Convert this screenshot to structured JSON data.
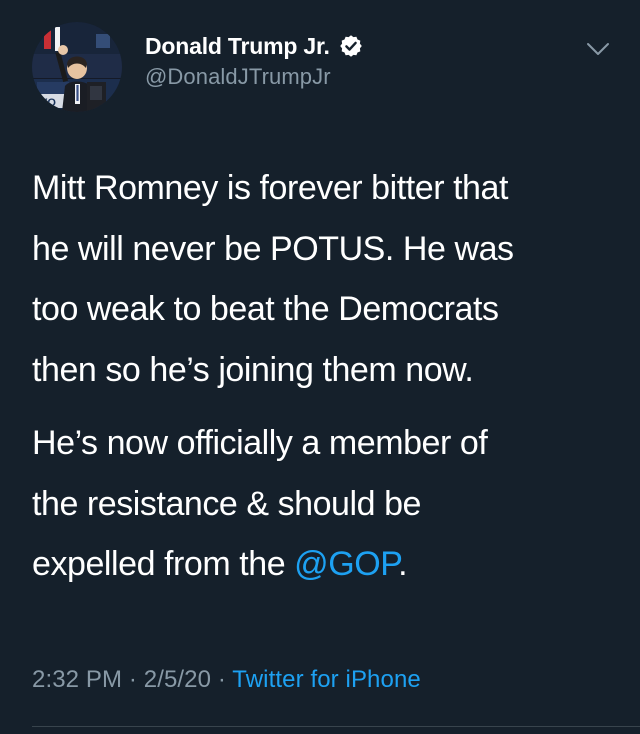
{
  "author": {
    "display_name": "Donald Trump Jr.",
    "handle": "@DonaldJTrumpJr",
    "verified": true,
    "avatar_icon": "profile-photo"
  },
  "tweet": {
    "line1": "Mitt Romney is forever bitter that",
    "line2": "he will never be POTUS. He was",
    "line3": "too weak to beat the Democrats",
    "line4": "then so he’s joining them now.",
    "line5": "He’s now officially a member of",
    "line6": "the resistance & should be",
    "line7_prefix": "expelled from the ",
    "mention": "@GOP",
    "line7_suffix": "."
  },
  "meta": {
    "time": "2:32 PM",
    "separator": "·",
    "date": "2/5/20",
    "source": "Twitter for iPhone"
  },
  "icons": {
    "verified": "verified-badge-icon",
    "menu": "chevron-down-icon"
  },
  "colors": {
    "background": "#15202b",
    "text": "#ffffff",
    "secondary": "#8899a6",
    "link": "#1da1f2"
  }
}
